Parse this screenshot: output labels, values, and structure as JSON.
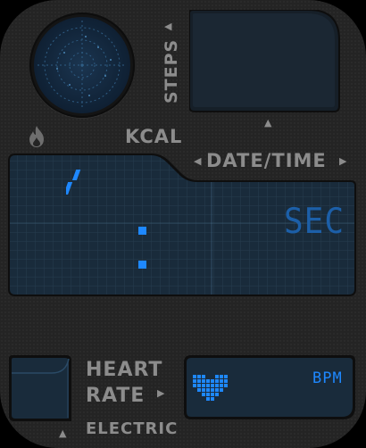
{
  "steps": {
    "label": "STEPS"
  },
  "calories": {
    "label": "KCAL",
    "icon": "flame-icon"
  },
  "datetime": {
    "label": "DATE/TIME",
    "separator": "/",
    "seconds_label": "SEC"
  },
  "heart_rate": {
    "label_line1": "HEART",
    "label_line2": "RATE",
    "unit": "BPM",
    "icon": "heart-pixel-icon"
  },
  "electric": {
    "label": "ELECTRIC"
  },
  "colors": {
    "accent": "#1e88ff",
    "panel": "#192b3b",
    "label": "#8c8c8c",
    "bezel": "#242424"
  }
}
